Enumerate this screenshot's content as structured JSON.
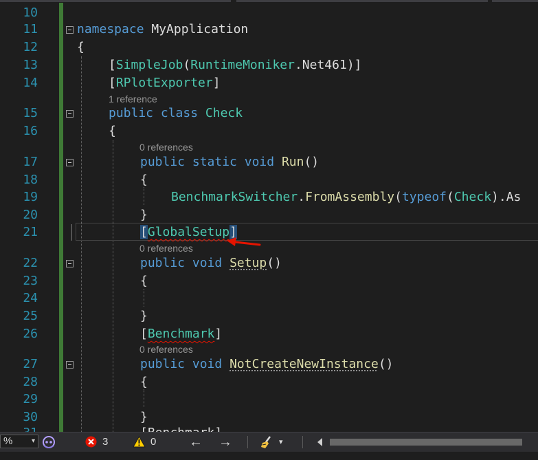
{
  "editor": {
    "line_numbers": [
      "10",
      "11",
      "12",
      "13",
      "14",
      "15",
      "16",
      "17",
      "18",
      "19",
      "20",
      "21",
      "22",
      "23",
      "24",
      "25",
      "26",
      "27",
      "28",
      "29",
      "30",
      "31"
    ],
    "code": {
      "l11_kw": "namespace",
      "l11_name": " MyApplication",
      "l12": "{",
      "l13_open": "[",
      "l13_attr": "SimpleJob",
      "l13_paren": "(",
      "l13_type": "RuntimeMoniker",
      "l13_dot": ".",
      "l13_member": "Net461",
      "l13_close": ")]",
      "l14_open": "[",
      "l14_attr": "RPlotExporter",
      "l14_close": "]",
      "lens_15": "1 reference",
      "l15_public": "public",
      "l15_class": "class",
      "l15_name": "Check",
      "l16": "{",
      "lens_17": "0 references",
      "l17_public": "public",
      "l17_static": "static",
      "l17_void": "void",
      "l17_name": "Run",
      "l17_parens": "()",
      "l18": "{",
      "l19_type": "BenchmarkSwitcher",
      "l19_dot": ".",
      "l19_method": "FromAssembly",
      "l19_paren": "(",
      "l19_typeof": "typeof",
      "l19_paren2": "(",
      "l19_check": "Check",
      "l19_rest": ").As",
      "l20": "}",
      "l21_open": "[",
      "l21_attr": "GlobalSetup",
      "l21_close": "]",
      "lens_22": "0 references",
      "l22_public": "public",
      "l22_void": "void",
      "l22_name": "Setup",
      "l22_parens": "()",
      "l23": "{",
      "l25": "}",
      "l26_open": "[",
      "l26_attr": "Benchmark",
      "l26_close": "]",
      "lens_27": "0 references",
      "l27_public": "public",
      "l27_void": "void",
      "l27_name": "NotCreateNewInstance",
      "l27_parens": "()",
      "l28": "{",
      "l30": "}",
      "l31_partial": "[Benchmark]"
    }
  },
  "status_bar": {
    "zoom_value": "%",
    "zoom_dropdown_glyph": "▾",
    "errors_count": "3",
    "warnings_count": "0",
    "back_glyph": "←",
    "forward_glyph": "→",
    "cleanup_dropdown_glyph": "▾",
    "icons": [
      "copilot-icon",
      "error-icon",
      "warning-icon",
      "back-arrow-icon",
      "forward-arrow-icon",
      "code-cleanup-brush-icon"
    ]
  },
  "colors": {
    "background": "#1e1e1e",
    "line_number": "#2b91af",
    "keyword": "#569cd6",
    "type": "#4ec9b0",
    "method": "#dcdcaa",
    "change_bar": "#3f7a36",
    "error": "#e51400",
    "status_bar": "#2d2d30"
  }
}
